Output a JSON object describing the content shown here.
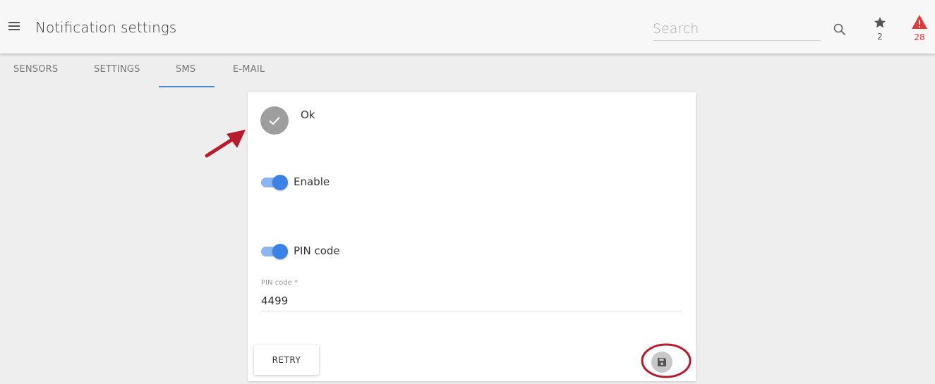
{
  "header": {
    "title": "Notification settings",
    "search_placeholder": "Search",
    "favorites_count": "2",
    "alerts_count": "28"
  },
  "tabs": [
    {
      "label": "SENSORS"
    },
    {
      "label": "SETTINGS"
    },
    {
      "label": "SMS",
      "active": true
    },
    {
      "label": "E-MAIL"
    }
  ],
  "card": {
    "status_text": "Ok",
    "enable_label": "Enable",
    "enable_on": true,
    "pin_toggle_label": "PIN code",
    "pin_toggle_on": true,
    "pin_field_label": "PIN code *",
    "pin_value": "4499",
    "retry_label": "RETRY"
  },
  "icons": {
    "menu": "menu-icon",
    "search": "search-icon",
    "favorites": "star-icon",
    "alerts": "warning-icon",
    "status": "check-icon",
    "save": "floppy-disk-icon"
  },
  "colors": {
    "accent": "#3b82e6",
    "tab_indicator": "#4a86d8",
    "alert": "#e53935",
    "status_circle": "#9e9e9e",
    "annotation": "#b71c2c"
  }
}
